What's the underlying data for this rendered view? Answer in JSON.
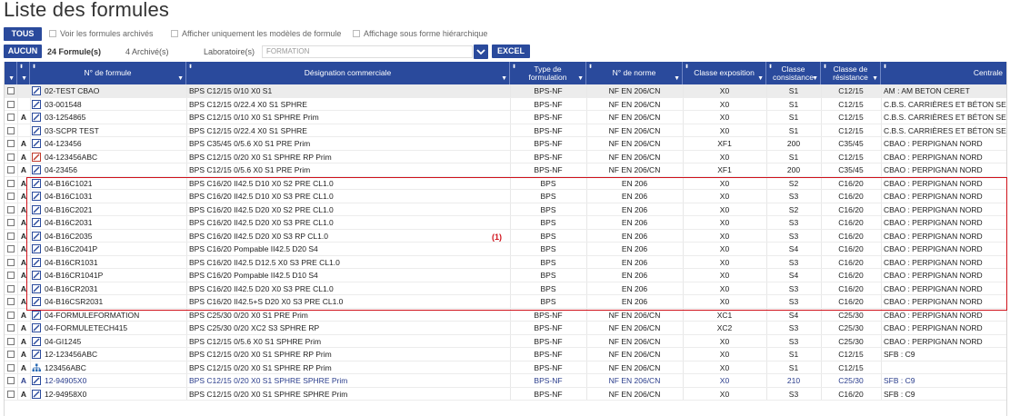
{
  "page": {
    "title": "Liste des formules"
  },
  "toolbar": {
    "all_label": "TOUS",
    "none_label": "AUCUN",
    "show_archived": "Voir les formules archivés",
    "only_models": "Afficher uniquement les modèles de formule",
    "hierarchical": "Affichage sous forme hiérarchique",
    "count_label": "24 Formule(s)",
    "archived_count": "4 Archivé(s)",
    "lab_label": "Laboratoire(s)",
    "lab_value": "FORMATION",
    "excel_label": "EXCEL"
  },
  "table": {
    "headers": {
      "num": "N° de formule",
      "designation": "Désignation commerciale",
      "type": "Type de formulation",
      "norme": "N° de norme",
      "expo": "Classe exposition",
      "consist": "Classe consistance",
      "resist": "Classe de résistance",
      "centrale": "Centrale"
    },
    "rows": [
      {
        "a": "",
        "icon": "formula",
        "num": "02-TEST CBAO",
        "des": "BPS C12/15 0/10 X0 S1",
        "type": "BPS-NF",
        "norme": "NF EN 206/CN",
        "expo": "X0",
        "cons": "S1",
        "res": "C12/15",
        "cent": "AM : AM BETON CERET",
        "style": "first"
      },
      {
        "a": "",
        "icon": "formula",
        "num": "03-001548",
        "des": "BPS C12/15 0/22.4 X0 S1 SPHRE",
        "type": "BPS-NF",
        "norme": "NF EN 206/CN",
        "expo": "X0",
        "cons": "S1",
        "res": "C12/15",
        "cent": "C.B.S. CARRIÈRES ET BÉTON SERVIC",
        "style": ""
      },
      {
        "a": "A",
        "icon": "formula",
        "num": "03-1254865",
        "des": "BPS C12/15 0/10 X0 S1 SPHRE Prim",
        "type": "BPS-NF",
        "norme": "NF EN 206/CN",
        "expo": "X0",
        "cons": "S1",
        "res": "C12/15",
        "cent": "C.B.S. CARRIÈRES ET BÉTON SERVIC",
        "style": ""
      },
      {
        "a": "",
        "icon": "formula",
        "num": "03-SCPR TEST",
        "des": "BPS C12/15 0/22.4 X0 S1 SPHRE",
        "type": "BPS-NF",
        "norme": "NF EN 206/CN",
        "expo": "X0",
        "cons": "S1",
        "res": "C12/15",
        "cent": "C.B.S. CARRIÈRES ET BÉTON SERVIC",
        "style": ""
      },
      {
        "a": "A",
        "icon": "formula",
        "num": "04-123456",
        "des": "BPS C35/45 0/5.6 X0 S1 PRE Prim",
        "type": "BPS-NF",
        "norme": "NF EN 206/CN",
        "expo": "XF1",
        "cons": "200",
        "res": "C35/45",
        "cent": "CBAO : PERPIGNAN NORD",
        "style": ""
      },
      {
        "a": "A",
        "icon": "formula-red",
        "num": "04-123456ABC",
        "des": "BPS C12/15 0/20 X0 S1 SPHRE RP Prim",
        "type": "BPS-NF",
        "norme": "NF EN 206/CN",
        "expo": "X0",
        "cons": "S1",
        "res": "C12/15",
        "cent": "CBAO : PERPIGNAN NORD",
        "style": ""
      },
      {
        "a": "A",
        "icon": "formula",
        "num": "04-23456",
        "des": "BPS C12/15 0/5.6 X0 S1 PRE Prim",
        "type": "BPS-NF",
        "norme": "NF EN 206/CN",
        "expo": "XF1",
        "cons": "200",
        "res": "C35/45",
        "cent": "CBAO : PERPIGNAN NORD",
        "style": ""
      },
      {
        "a": "A",
        "icon": "formula",
        "num": "04-B16C1021",
        "des": "BPS C16/20 II42.5 D10 X0 S2 PRE CL1.0",
        "type": "BPS",
        "norme": "EN 206",
        "expo": "X0",
        "cons": "S2",
        "res": "C16/20",
        "cent": "CBAO : PERPIGNAN NORD",
        "style": ""
      },
      {
        "a": "A",
        "icon": "formula",
        "num": "04-B16C1031",
        "des": "BPS C16/20 II42.5 D10 X0 S3 PRE CL1.0",
        "type": "BPS",
        "norme": "EN 206",
        "expo": "X0",
        "cons": "S3",
        "res": "C16/20",
        "cent": "CBAO : PERPIGNAN NORD",
        "style": ""
      },
      {
        "a": "A",
        "icon": "formula",
        "num": "04-B16C2021",
        "des": "BPS C16/20 II42.5 D20 X0 S2 PRE CL1.0",
        "type": "BPS",
        "norme": "EN 206",
        "expo": "X0",
        "cons": "S2",
        "res": "C16/20",
        "cent": "CBAO : PERPIGNAN NORD",
        "style": ""
      },
      {
        "a": "A",
        "icon": "formula",
        "num": "04-B16C2031",
        "des": "BPS C16/20 II42.5 D20 X0 S3 PRE CL1.0",
        "type": "BPS",
        "norme": "EN 206",
        "expo": "X0",
        "cons": "S3",
        "res": "C16/20",
        "cent": "CBAO : PERPIGNAN NORD",
        "style": ""
      },
      {
        "a": "A",
        "icon": "formula",
        "num": "04-B16C2035",
        "des": "BPS C16/20 II42.5 D20 X0 S3 RP CL1.0",
        "type": "BPS",
        "norme": "EN 206",
        "expo": "X0",
        "cons": "S3",
        "res": "C16/20",
        "cent": "CBAO : PERPIGNAN NORD",
        "style": ""
      },
      {
        "a": "A",
        "icon": "formula",
        "num": "04-B16C2041P",
        "des": "BPS C16/20 Pompable II42.5 D20 S4",
        "type": "BPS",
        "norme": "EN 206",
        "expo": "X0",
        "cons": "S4",
        "res": "C16/20",
        "cent": "CBAO : PERPIGNAN NORD",
        "style": ""
      },
      {
        "a": "A",
        "icon": "formula",
        "num": "04-B16CR1031",
        "des": "BPS C16/20 II42.5 D12.5 X0 S3 PRE CL1.0",
        "type": "BPS",
        "norme": "EN 206",
        "expo": "X0",
        "cons": "S3",
        "res": "C16/20",
        "cent": "CBAO : PERPIGNAN NORD",
        "style": ""
      },
      {
        "a": "A",
        "icon": "formula",
        "num": "04-B16CR1041P",
        "des": "BPS C16/20 Pompable II42.5 D10 S4",
        "type": "BPS",
        "norme": "EN 206",
        "expo": "X0",
        "cons": "S4",
        "res": "C16/20",
        "cent": "CBAO : PERPIGNAN NORD",
        "style": ""
      },
      {
        "a": "A",
        "icon": "formula",
        "num": "04-B16CR2031",
        "des": "BPS C16/20 II42.5 D20 X0 S3 PRE CL1.0",
        "type": "BPS",
        "norme": "EN 206",
        "expo": "X0",
        "cons": "S3",
        "res": "C16/20",
        "cent": "CBAO : PERPIGNAN NORD",
        "style": ""
      },
      {
        "a": "A",
        "icon": "formula",
        "num": "04-B16CSR2031",
        "des": "BPS C16/20 II42.5+S D20 X0 S3 PRE CL1.0",
        "type": "BPS",
        "norme": "EN 206",
        "expo": "X0",
        "cons": "S3",
        "res": "C16/20",
        "cent": "CBAO : PERPIGNAN NORD",
        "style": ""
      },
      {
        "a": "A",
        "icon": "formula",
        "num": "04-FORMULEFORMATION",
        "des": "BPS C25/30 0/20 X0 S1 PRE Prim",
        "type": "BPS-NF",
        "norme": "NF EN 206/CN",
        "expo": "XC1",
        "cons": "S4",
        "res": "C25/30",
        "cent": "CBAO : PERPIGNAN NORD",
        "style": ""
      },
      {
        "a": "A",
        "icon": "formula",
        "num": "04-FORMULETECH415",
        "des": "BPS C25/30 0/20 XC2 S3 SPHRE RP",
        "type": "BPS-NF",
        "norme": "NF EN 206/CN",
        "expo": "XC2",
        "cons": "S3",
        "res": "C25/30",
        "cent": "CBAO : PERPIGNAN NORD",
        "style": ""
      },
      {
        "a": "A",
        "icon": "formula",
        "num": "04-GI1245",
        "des": "BPS C12/15 0/5.6 X0 S1 SPHRE Prim",
        "type": "BPS-NF",
        "norme": "NF EN 206/CN",
        "expo": "X0",
        "cons": "S3",
        "res": "C25/30",
        "cent": "CBAO : PERPIGNAN NORD",
        "style": ""
      },
      {
        "a": "A",
        "icon": "formula",
        "num": "12-123456ABC",
        "des": "BPS C12/15 0/20 X0 S1 SPHRE RP Prim",
        "type": "BPS-NF",
        "norme": "NF EN 206/CN",
        "expo": "X0",
        "cons": "S1",
        "res": "C12/15",
        "cent": "SFB : C9",
        "style": ""
      },
      {
        "a": "A",
        "icon": "tree",
        "num": "123456ABC",
        "des": "BPS C12/15 0/20 X0 S1 SPHRE RP Prim",
        "type": "BPS-NF",
        "norme": "NF EN 206/CN",
        "expo": "X0",
        "cons": "S1",
        "res": "C12/15",
        "cent": "",
        "style": ""
      },
      {
        "a": "A",
        "icon": "formula",
        "num": "12-94905X0",
        "des": "BPS C12/15 0/20 X0 S1 SPHRE SPHRE Prim",
        "type": "BPS-NF",
        "norme": "NF EN 206/CN",
        "expo": "X0",
        "cons": "210",
        "res": "C25/30",
        "cent": "SFB : C9",
        "style": "blue"
      },
      {
        "a": "A",
        "icon": "formula",
        "num": "12-94958X0",
        "des": "BPS C12/15 0/20 X0 S1 SPHRE SPHRE Prim",
        "type": "BPS-NF",
        "norme": "NF EN 206/CN",
        "expo": "X0",
        "cons": "S3",
        "res": "C16/20",
        "cent": "SFB : C9",
        "style": ""
      }
    ]
  },
  "annotation": {
    "label": "(1)",
    "color": "#d0121b"
  },
  "colors": {
    "header": "#2a4a9c",
    "accent_red": "#d0121b"
  }
}
